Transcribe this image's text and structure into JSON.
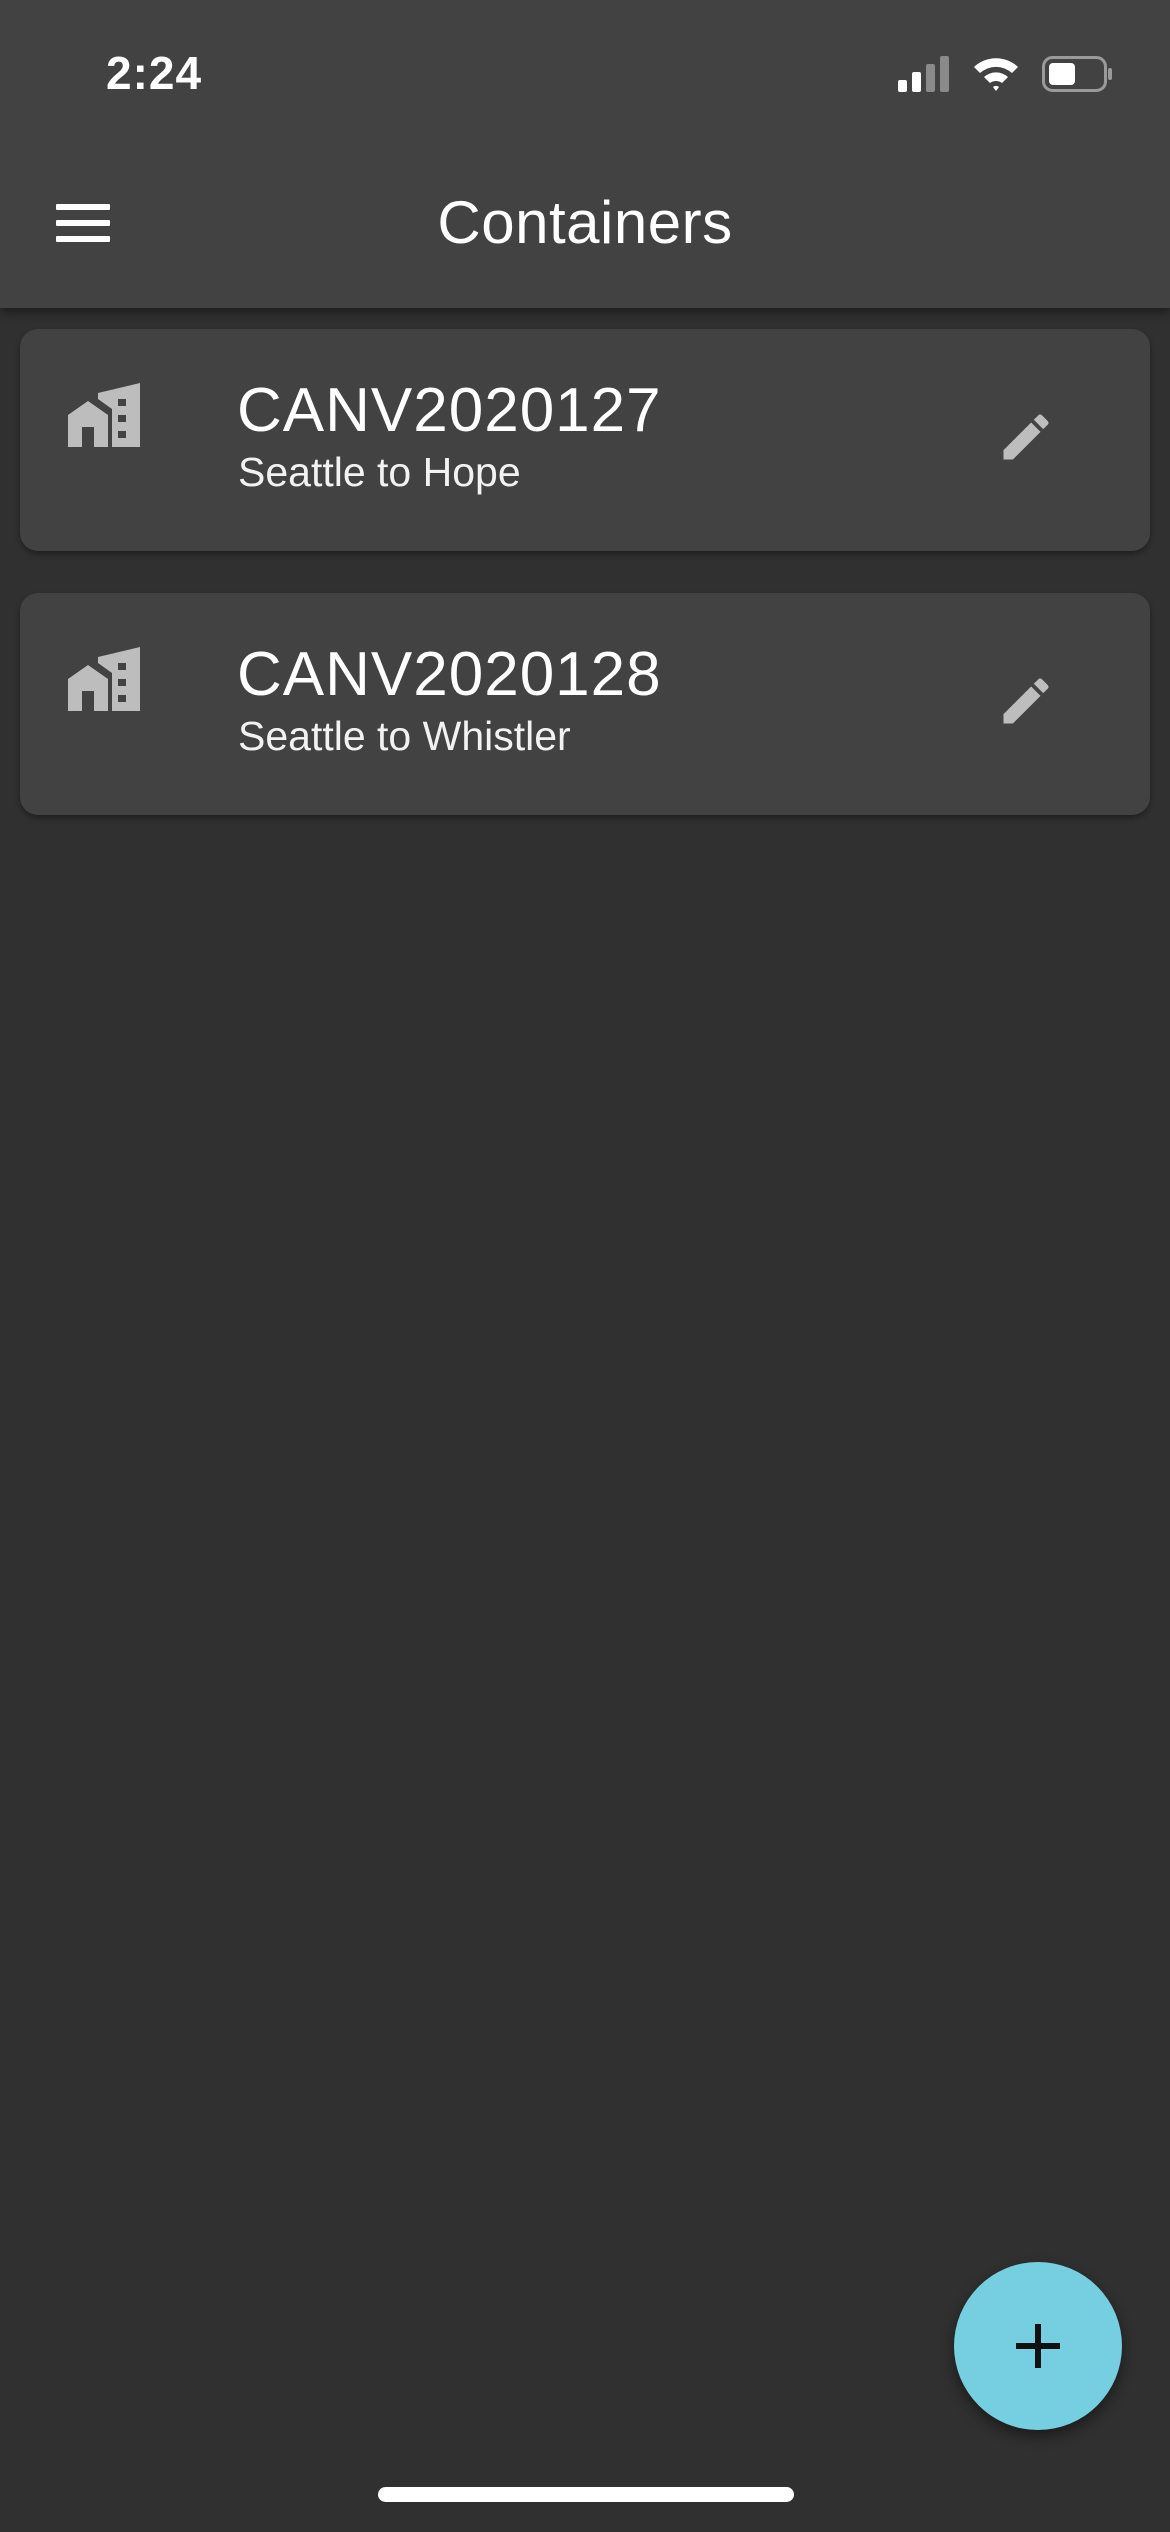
{
  "status_bar": {
    "time": "2:24",
    "icons": [
      "cellular-signal-icon",
      "wifi-icon",
      "battery-icon"
    ]
  },
  "app_bar": {
    "title": "Containers",
    "menu_icon": "hamburger-menu-icon"
  },
  "containers": [
    {
      "name": "CANV2020127",
      "route": "Seattle to Hope",
      "icon": "building-icon",
      "action_icon": "edit-pencil-icon"
    },
    {
      "name": "CANV2020128",
      "route": "Seattle to Whistler",
      "icon": "building-icon",
      "action_icon": "edit-pencil-icon"
    }
  ],
  "fab": {
    "icon": "plus-icon"
  },
  "colors": {
    "background": "#303030",
    "surface": "#424242",
    "accent": "#76cfe0",
    "icon_gray": "#bdbdbd"
  }
}
